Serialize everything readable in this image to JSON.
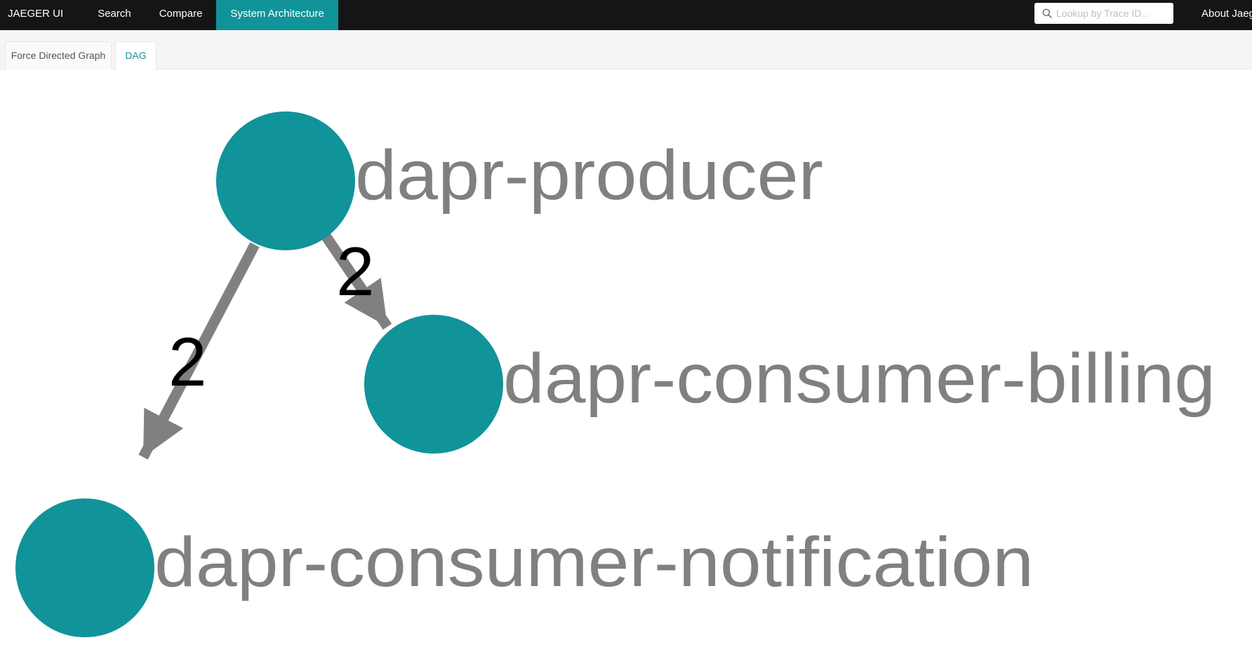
{
  "app": {
    "brand": "JAEGER UI",
    "nav": [
      {
        "label": "Search"
      },
      {
        "label": "Compare"
      },
      {
        "label": "System Architecture"
      }
    ],
    "active_nav": "System Architecture",
    "search": {
      "placeholder": "Lookup by Trace ID...",
      "value": "",
      "icon": "search-icon"
    },
    "about": "About Jaeg"
  },
  "tabs": [
    {
      "label": "Force Directed Graph"
    },
    {
      "label": "DAG"
    }
  ],
  "active_tab": "DAG",
  "colors": {
    "topbar_bg": "#151515",
    "accent": "#11939a",
    "node_fill": "#11939a",
    "edge": "#808080",
    "node_label": "#808080",
    "edge_label": "#000000"
  },
  "dag": {
    "nodes": [
      {
        "id": "dapr-producer",
        "label": "dapr-producer"
      },
      {
        "id": "dapr-consumer-billing",
        "label": "dapr-consumer-billing"
      },
      {
        "id": "dapr-consumer-notification",
        "label": "dapr-consumer-notification"
      }
    ],
    "edges": [
      {
        "from": "dapr-producer",
        "to": "dapr-consumer-billing",
        "label": "2"
      },
      {
        "from": "dapr-producer",
        "to": "dapr-consumer-notification",
        "label": "2"
      }
    ]
  }
}
